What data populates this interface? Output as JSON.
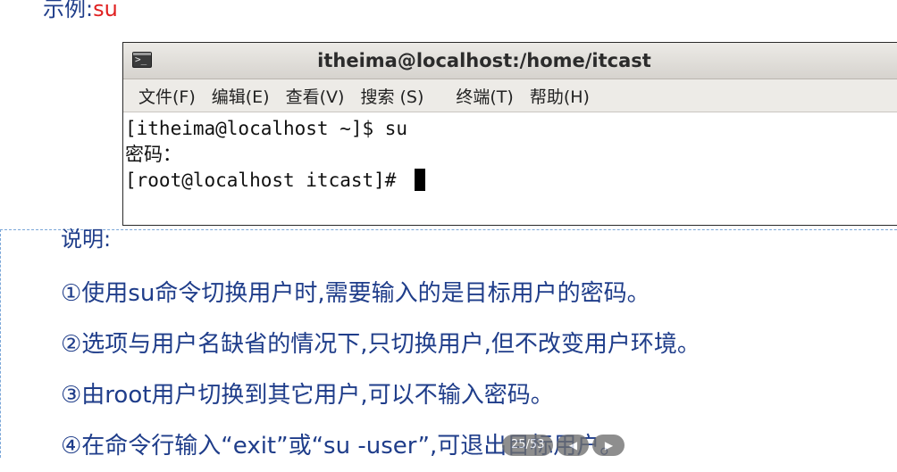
{
  "heading": {
    "label": "示例:",
    "command": "su"
  },
  "terminal": {
    "title": "itheima@localhost:/home/itcast",
    "icon": "terminal-icon",
    "menu": [
      "文件(F)",
      "编辑(E)",
      "查看(V)",
      "搜索 (S)",
      "终端(T)",
      "帮助(H)"
    ],
    "lines": [
      "[itheima@localhost ~]$ su",
      "密码：",
      "[root@localhost itcast]# "
    ]
  },
  "notes": {
    "heading": "说明:",
    "items": [
      "①使用su命令切换用户时,需要输入的是目标用户的密码。",
      "②选项与用户名缺省的情况下,只切换用户,但不改变用户环境。",
      "③由root用户切换到其它用户,可以不输入密码。",
      "④在命令行输入“exit”或“su -user”,可退出目标用户。"
    ]
  },
  "overlay": {
    "page_label": "25/53",
    "prev_icon": "prev-icon",
    "next_icon": "next-icon"
  },
  "colors": {
    "text_blue": "#1f3d8a",
    "command_red": "#e02020"
  }
}
